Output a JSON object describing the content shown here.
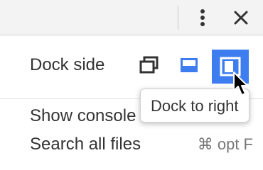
{
  "menu": {
    "dock_side_label": "Dock side",
    "dock_buttons": [
      {
        "icon": "undock-icon",
        "name": "Undock into separate window"
      },
      {
        "icon": "dock-bottom-icon",
        "name": "Dock to bottom"
      },
      {
        "icon": "dock-right-icon",
        "name": "Dock to right",
        "selected": true
      }
    ],
    "items": [
      {
        "label": "Show console drawer",
        "shortcut": ""
      },
      {
        "label": "Search all files",
        "shortcut": "⌘ opt F"
      }
    ]
  },
  "tooltip": {
    "text": "Dock to right"
  },
  "colors": {
    "accent": "#3d7df0",
    "text": "#333333",
    "shortcut": "#777777",
    "toolbar_bg": "#f3f3f3"
  }
}
